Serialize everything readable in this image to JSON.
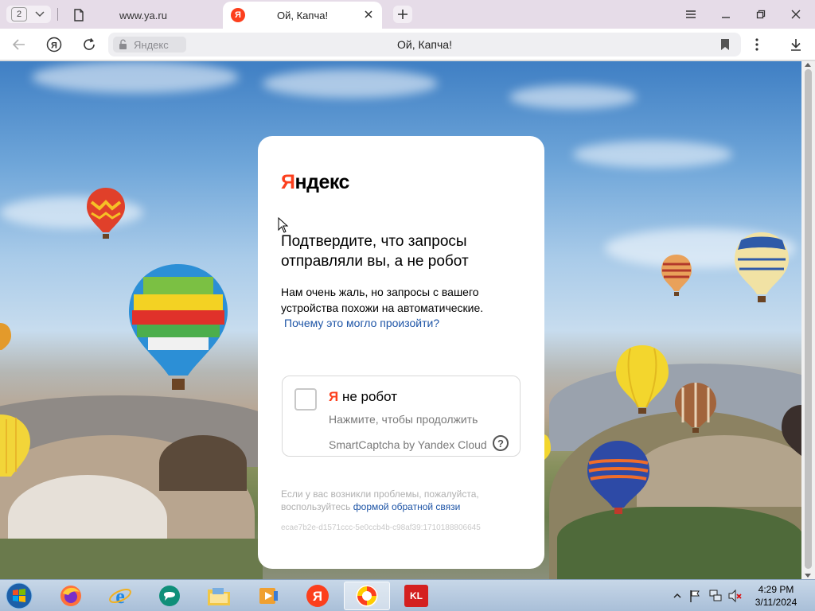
{
  "browser": {
    "tab_count": "2",
    "tabs": [
      {
        "title": "www.ya.ru",
        "active": false
      },
      {
        "title": "Ой, Капча!",
        "active": true,
        "favicon": "Я"
      }
    ],
    "address": {
      "site_label": "Яндекс",
      "page_title": "Ой, Капча!"
    }
  },
  "card": {
    "logo_first": "Я",
    "logo_rest": "ндекс",
    "heading": "Подтвердите, что запросы отправляли вы, а не робот",
    "description": "Нам очень жаль, но запросы с вашего устройства похожи на автоматические.",
    "why_link": "Почему это могло произойти?",
    "captcha": {
      "title_prefix": "Я",
      "title_rest": " не робот",
      "hint": "Нажмите, чтобы продолжить",
      "brand": "SmartCaptcha by Yandex Cloud",
      "help": "?"
    },
    "footer_text": "Если у вас возникли проблемы, пожалуйста, воспользуйтесь",
    "footer_link": "формой обратной связи",
    "request_id": "ecae7b2e-d1571ccc-5e0ccb4b-c98af39:1710188806645"
  },
  "taskbar": {
    "clock_time": "4:29 PM",
    "clock_date": "3/11/2024",
    "apps": [
      "firefox-icon",
      "internet-explorer-icon",
      "chat-icon",
      "file-explorer-icon",
      "media-player-icon",
      "yandex-icon",
      "yandex-browser-icon",
      "kl-icon"
    ],
    "kl_label": "KL"
  },
  "colors": {
    "yandex_red": "#fc3f1d",
    "link_blue": "#1d54a6"
  }
}
